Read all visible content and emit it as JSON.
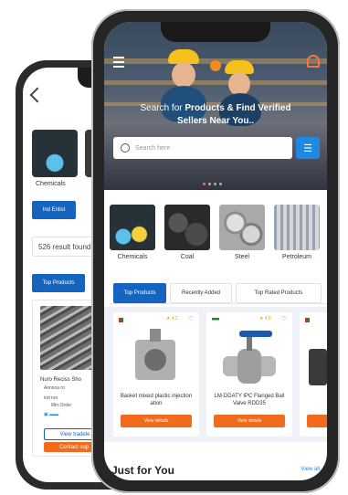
{
  "back_screen": {
    "categories": [
      {
        "label": "Chemicals"
      }
    ],
    "enquiry_button": "Ind Enlist",
    "result_text": "526 result found",
    "tab_label": "Top Products",
    "product": {
      "name": "Nuro Reciss Sho",
      "line2": "Aonsoa ro",
      "line3": "ind nor",
      "line4": "Min.Order",
      "view_btn": "View tradele",
      "contact_btn": "Contact sup"
    }
  },
  "front_screen": {
    "hero": {
      "line1_prefix": "Search for ",
      "line1_bold": "Products & Find Verified",
      "line2_bold": "Sellers Near You.."
    },
    "search": {
      "placeholder": "Search here"
    },
    "categories": [
      {
        "label": "Chemicals"
      },
      {
        "label": "Coal"
      },
      {
        "label": "Steel"
      },
      {
        "label": "Petroleum"
      }
    ],
    "tabs": [
      {
        "label": "Top Products",
        "active": true
      },
      {
        "label": "Recently Added",
        "active": false
      },
      {
        "label": "Top Rated Products",
        "active": false
      }
    ],
    "products": [
      {
        "rating": "4.2",
        "name": "Basket mixed plastic injection ation",
        "button": "View details"
      },
      {
        "rating": "4.6",
        "name": "LM-DDATY IPC Flanged Ball Valve RDD35",
        "button": "View details"
      },
      {
        "rating": "4.6",
        "name": "",
        "button": ""
      }
    ],
    "section_title": "Just for You",
    "view_all": "View all"
  },
  "colors": {
    "primary_blue": "#1565c0",
    "accent_orange": "#f26b1d",
    "search_blue": "#1e88e5"
  }
}
